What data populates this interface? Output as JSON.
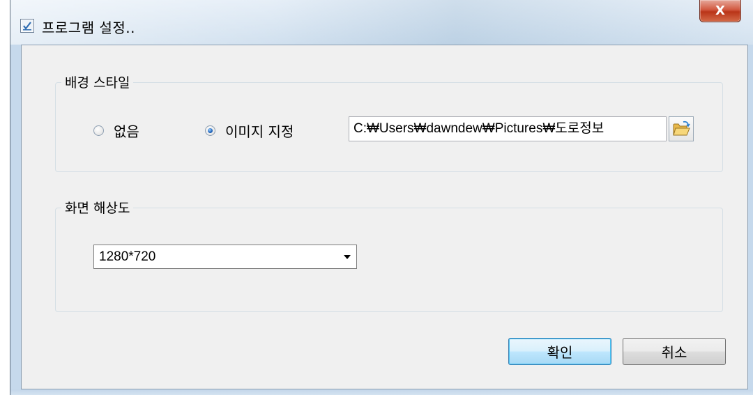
{
  "window": {
    "title": "프로그램 설정..",
    "close_label": "X"
  },
  "background_style": {
    "group_title": "배경 스타일",
    "options": [
      {
        "label": "없음",
        "checked": false
      },
      {
        "label": "이미지 지정",
        "checked": true
      }
    ],
    "image_path": "C:₩Users₩dawndew₩Pictures₩도로정보",
    "browse_icon": "folder-open-icon"
  },
  "resolution": {
    "group_title": "화면 해상도",
    "selected": "1280*720"
  },
  "buttons": {
    "ok_label": "확인",
    "cancel_label": "취소"
  },
  "colors": {
    "close_button": "#c8452b",
    "default_button_border": "#3c7fb1"
  }
}
